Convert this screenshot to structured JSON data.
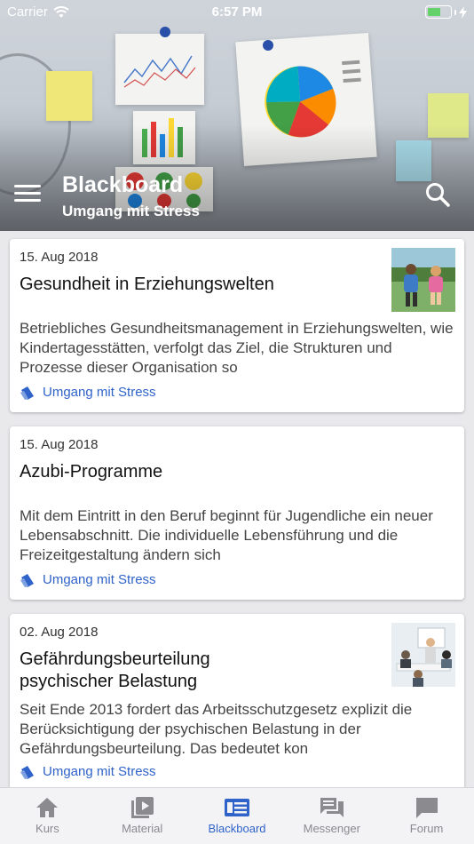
{
  "status_bar": {
    "carrier": "Carrier",
    "time": "6:57 PM"
  },
  "header": {
    "title": "Blackboard",
    "subtitle": "Umgang mit Stress"
  },
  "posts": [
    {
      "date": "15. Aug 2018",
      "title": "Gesundheit in Erziehungswelten",
      "excerpt": "Betriebliches Gesundheitsmanagement in Erziehungswelten, wie Kindertagesstätten, verfolgt das Ziel, die Strukturen und Prozesse dieser Organisation so",
      "tag": "Umgang mit Stress",
      "thumbnail": "children-playing-photo"
    },
    {
      "date": "15. Aug 2018",
      "title": "Azubi-Programme",
      "excerpt": "Mit dem Eintritt in den Beruf beginnt für Jugendliche ein neuer Lebensabschnitt. Die individuelle Lebensführung und die Freizeitgestaltung ändern sich",
      "tag": "Umgang mit Stress"
    },
    {
      "date": "02. Aug 2018",
      "title_line1": "Gefährdungsbeurteilung",
      "title_line2": "psychischer Belastung",
      "excerpt": "Seit Ende 2013 fordert das Arbeitsschutzgesetz explizit die Berücksichtigung der psychischen Belastung in der Gefährdungsbeurteilung. Das bedeutet kon",
      "tag": "Umgang mit Stress",
      "thumbnail": "office-meeting-photo"
    }
  ],
  "tabs": [
    {
      "label": "Kurs",
      "icon": "home-icon"
    },
    {
      "label": "Material",
      "icon": "video-library-icon"
    },
    {
      "label": "Blackboard",
      "icon": "blackboard-icon"
    },
    {
      "label": "Messenger",
      "icon": "chat-icon"
    },
    {
      "label": "Forum",
      "icon": "forum-icon"
    }
  ],
  "colors": {
    "accent": "#2f63c9",
    "tab_inactive": "#8a8a8f",
    "battery": "#65d16b"
  },
  "battery_level": 0.6
}
